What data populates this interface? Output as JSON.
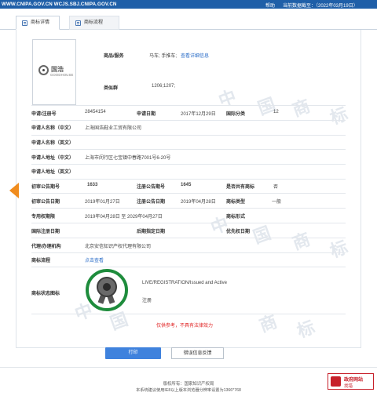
{
  "topbar": {
    "site": "WWW.CNIPA.GOV.CN WCJS.SBJ.CNIPA.GOV.CN",
    "help": "帮助",
    "date": "当前数据截至：（2022年03月19日）"
  },
  "tabs": [
    {
      "label": "商标详情"
    },
    {
      "label": "商标流程"
    }
  ],
  "logo": {
    "cn": "国浩",
    "en": "GOODHOUSE"
  },
  "fields": {
    "goods_label": "商品/服务",
    "goods_value": "马车; 手推车;",
    "goods_link": "查看详细信息",
    "class_group_label": "类似群",
    "class_group_value": "1206;1207;",
    "reg_no_label": "申请/注册号",
    "reg_no_value": "28454154",
    "app_date_label": "申请日期",
    "app_date_value": "2017年12月29日",
    "intl_class_label": "国际分类",
    "intl_class_value": "12",
    "applicant_cn_label": "申请人名称（中文）",
    "applicant_cn_value": "上海国浩鞋业工贸有限公司",
    "applicant_en_label": "申请人名称（英文）",
    "address_cn_label": "申请人地址（中文）",
    "address_cn_value": "上海市闵行区七宝镇中春路7001号6-20号",
    "address_en_label": "申请人地址（英文）",
    "prelim_no_label": "初审公告期号",
    "prelim_no_value": "1633",
    "reg_pub_no_label": "注册公告期号",
    "reg_pub_no_value": "1645",
    "shared_label": "是否共有商标",
    "shared_value": "否",
    "prelim_date_label": "初审公告日期",
    "prelim_date_value": "2019年01月27日",
    "reg_pub_date_label": "注册公告日期",
    "reg_pub_date_value": "2019年04月28日",
    "tm_type_label": "商标类型",
    "tm_type_value": "一般",
    "exclusive_label": "专用权期限",
    "exclusive_value": "2019年04月28日 至 2029年04月27日",
    "tm_form_label": "商标形式",
    "intl_reg_date_label": "国际注册日期",
    "late_spec_date_label": "后期指定日期",
    "priority_date_label": "优先权日期",
    "agent_label": "代理/办理机构",
    "agent_value": "北京安信知识产权代理有限公司",
    "process_label": "商标流程",
    "process_link": "点击查看",
    "status_label": "商标状态图标",
    "status_en": "LIVE/REGISTRATION/Issued and Active",
    "status_cn": "注册"
  },
  "notice": "仅供参考，不具有法律效力",
  "buttons": {
    "print": "打印",
    "feedback": "错误信息反馈"
  },
  "footer": {
    "line1": "版权所有：国家知识产权局",
    "line2": "本系统建议使用IE8以上版本浏览器分辨率设置为1366*768"
  },
  "gov_badge": {
    "t1": "政府网站",
    "t2": "找错"
  },
  "watermark": [
    "中",
    "国",
    "商",
    "标"
  ],
  "colors": {
    "topbar": "#1f5fa8",
    "accent_link": "#2a6dc8",
    "print_button": "#3f82dd",
    "seal_green": "#1e8c3c",
    "notice_red": "#e02020",
    "prev_arrow": "#f08c1e",
    "next_arrow": "#4a8cd8"
  }
}
